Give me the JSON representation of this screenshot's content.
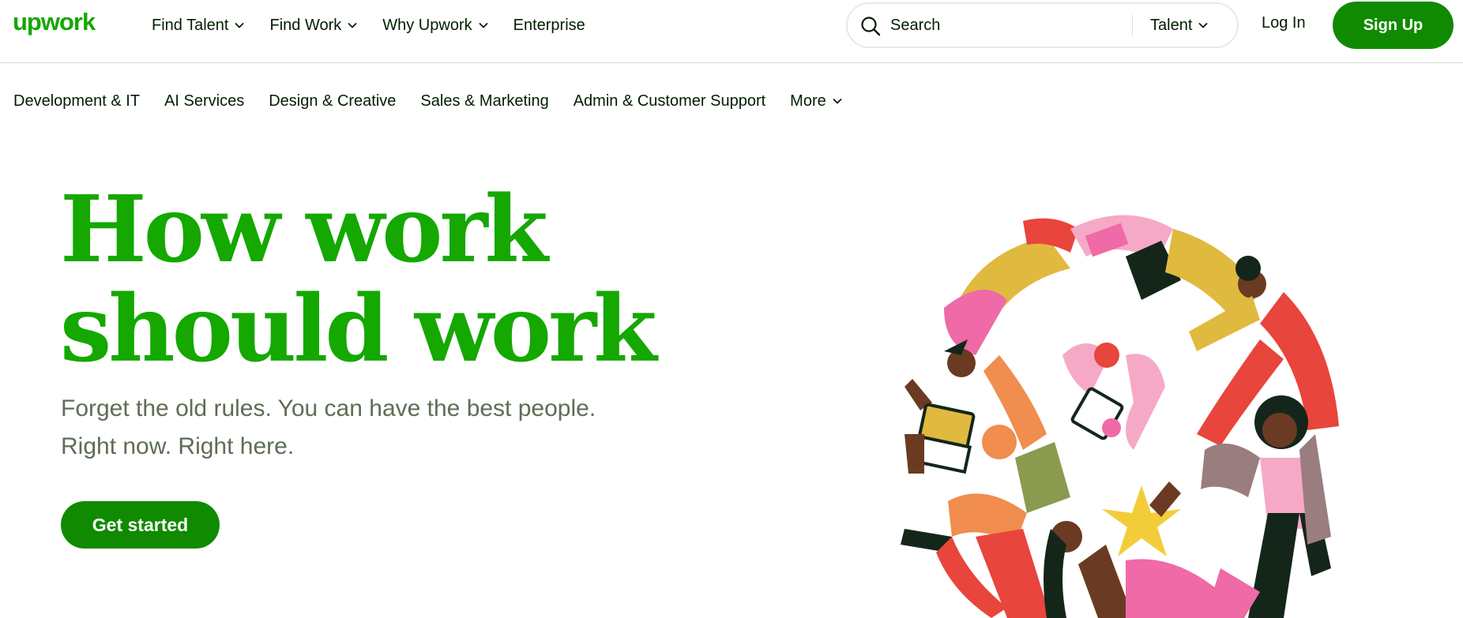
{
  "brand": {
    "logo_text": "upwork",
    "color": "#14a800",
    "button_color": "#108a00"
  },
  "header": {
    "nav": [
      {
        "label": "Find Talent",
        "has_dropdown": true
      },
      {
        "label": "Find Work",
        "has_dropdown": true
      },
      {
        "label": "Why Upwork",
        "has_dropdown": true
      },
      {
        "label": "Enterprise",
        "has_dropdown": false
      }
    ],
    "search": {
      "placeholder": "Search",
      "value": "",
      "scope": "Talent",
      "icon": "search-icon"
    },
    "login_label": "Log In",
    "signup_label": "Sign Up"
  },
  "categories": [
    {
      "label": "Development & IT"
    },
    {
      "label": "AI Services"
    },
    {
      "label": "Design & Creative"
    },
    {
      "label": "Sales & Marketing"
    },
    {
      "label": "Admin & Customer Support"
    },
    {
      "label": "More",
      "has_dropdown": true
    }
  ],
  "hero": {
    "title_line1": "How work",
    "title_line2": "should work",
    "subtitle_line1": "Forget the old rules. You can have the best people.",
    "subtitle_line2": "Right now. Right here.",
    "cta_label": "Get started",
    "illustration": "people-collaboration-illustration"
  }
}
